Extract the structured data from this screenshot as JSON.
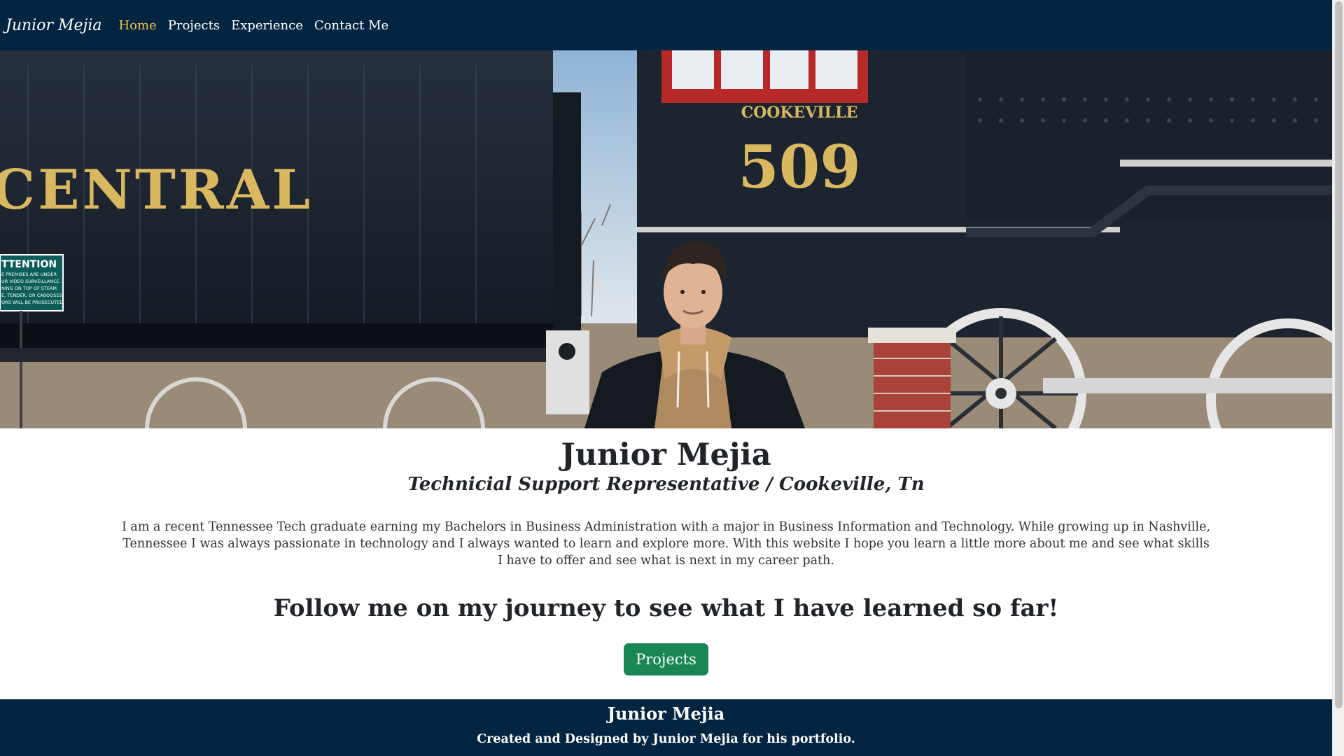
{
  "nav": {
    "brand": "Junior Mejia",
    "links": [
      {
        "label": "Home",
        "active": true
      },
      {
        "label": "Projects",
        "active": false
      },
      {
        "label": "Experience",
        "active": false
      },
      {
        "label": "Contact Me",
        "active": false
      }
    ]
  },
  "hero": {
    "train_text_left": "CENTRAL",
    "train_city": "COOKEVILLE",
    "train_number": "509",
    "sign_heading": "TTENTION",
    "sign_lines": [
      "E PREMISES ARE UNDER",
      "UR VIDEO SURVEILLANCE",
      "NING ON TOP OF STEAM",
      "E, TENDER, OR CABOOSES",
      "ORS WILL BE PROSECUTED"
    ]
  },
  "main": {
    "name": "Junior Mejia",
    "title": "Technicial Support Representative / Cookeville, Tn",
    "bio": "I am a recent Tennessee Tech graduate earning my Bachelors in Business Administration with a major in Business Information and Technology. While growing up in Nashville, Tennessee I was always passionate in technology and I always wanted to learn and explore more. With this website I hope you learn a little more about me and see what skills I have to offer and see what is next in my career path.",
    "tagline": "Follow me on my journey to see what I have learned so far!",
    "cta_label": "Projects"
  },
  "footer": {
    "name": "Junior Mejia",
    "credit": "Created and Designed by Junior Mejia for his portfolio."
  },
  "colors": {
    "navbar": "#032541",
    "active_link": "#f0c14b",
    "button": "#198754"
  }
}
